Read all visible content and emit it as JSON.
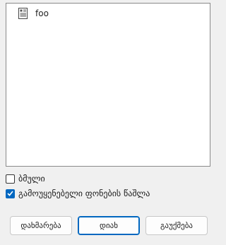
{
  "file_list": {
    "items": [
      {
        "label": "foo",
        "icon": "document-icon"
      }
    ]
  },
  "options": {
    "hidden_label": "ბმული",
    "hidden_checked": false,
    "delete_unused_label": "გამოუყენებელი ფონების წაშლა",
    "delete_unused_checked": true
  },
  "buttons": {
    "help": "დახმარება",
    "ok": "დიახ",
    "cancel": "გაუქმება"
  },
  "colors": {
    "accent": "#0067c0"
  }
}
